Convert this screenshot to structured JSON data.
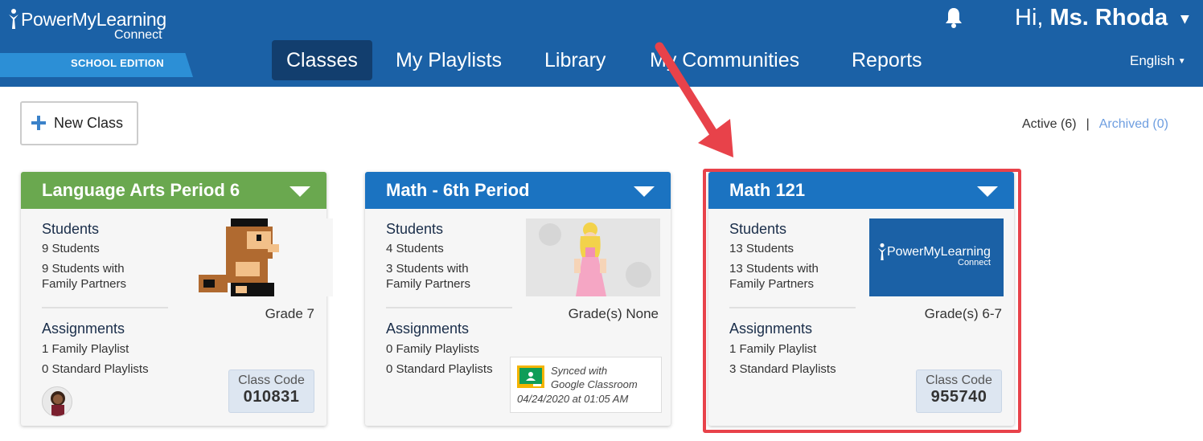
{
  "header": {
    "logo": {
      "name": "PowerMyLearning",
      "sub": "Connect",
      "edition": "SCHOOL EDITION"
    },
    "nav": [
      "Classes",
      "My Playlists",
      "Library",
      "My Communities",
      "Reports"
    ],
    "active_nav": "Classes",
    "greeting_prefix": "Hi,",
    "user_name": "Ms. Rhoda",
    "language": "English"
  },
  "toolbar": {
    "new_class_label": "New Class",
    "active_label": "Active (6)",
    "separator": "|",
    "archived_label": "Archived (0)"
  },
  "cards": [
    {
      "title": "Language Arts Period 6",
      "color": "#6aa84f",
      "students_label": "Students",
      "students_count": "9 Students",
      "family_line1": "9 Students with",
      "family_line2": "Family Partners",
      "grade": "Grade 7",
      "assignments_label": "Assignments",
      "family_playlists": "1 Family Playlist",
      "standard_playlists": "0 Standard Playlists",
      "code_label": "Class Code",
      "code_value": "010831"
    },
    {
      "title": "Math - 6th Period",
      "color": "#1b73c1",
      "students_label": "Students",
      "students_count": "4 Students",
      "family_line1": "3 Students with",
      "family_line2": "Family Partners",
      "grade": "Grade(s) None",
      "assignments_label": "Assignments",
      "family_playlists": "0 Family Playlists",
      "standard_playlists": "0 Standard Playlists",
      "synced_line1": "Synced with",
      "synced_line2": "Google Classroom",
      "synced_date": "04/24/2020 at 01:05 AM"
    },
    {
      "title": "Math 121",
      "color": "#1b73c1",
      "students_label": "Students",
      "students_count": "13 Students",
      "family_line1": "13 Students with",
      "family_line2": "Family Partners",
      "grade": "Grade(s) 6-7",
      "assignments_label": "Assignments",
      "family_playlists": "1 Family Playlist",
      "standard_playlists": "3 Standard Playlists",
      "code_label": "Class Code",
      "code_value": "955740",
      "thumb_logo": "PowerMyLearning",
      "thumb_sub": "Connect"
    }
  ],
  "colors": {
    "header": "#1b61a6",
    "highlight": "#e8424a"
  }
}
